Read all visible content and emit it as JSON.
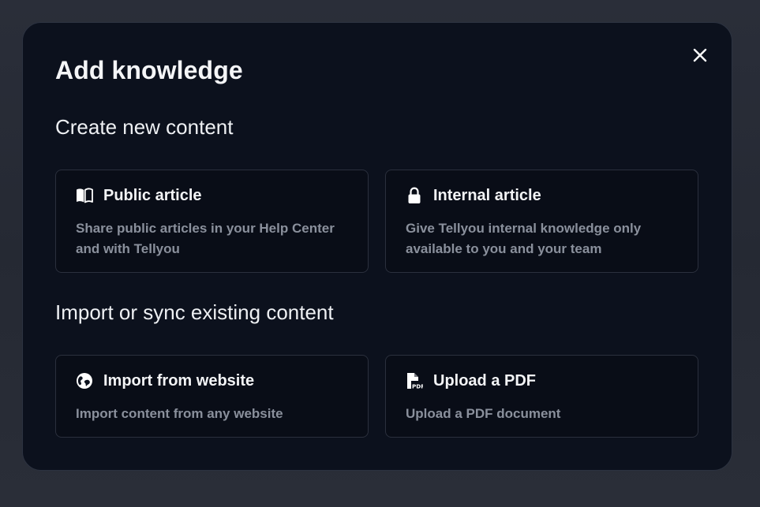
{
  "modal": {
    "title": "Add knowledge",
    "close_icon": "close-icon"
  },
  "sections": [
    {
      "title": "Create new content",
      "cards": [
        {
          "icon": "book-open-icon",
          "title": "Public article",
          "description": "Share public articles in your Help Center and with Tellyou"
        },
        {
          "icon": "lock-icon",
          "title": "Internal article",
          "description": "Give Tellyou internal knowledge only available to you and your team"
        }
      ]
    },
    {
      "title": "Import or sync existing content",
      "cards": [
        {
          "icon": "globe-icon",
          "title": "Import from website",
          "description": "Import content from any website"
        },
        {
          "icon": "pdf-file-icon",
          "title": "Upload a PDF",
          "description": "Upload a PDF document"
        }
      ]
    }
  ],
  "colors": {
    "page_background": "#272b36",
    "modal_background": "#0c111d",
    "card_background": "#090d17",
    "border": "#2b303d",
    "text_primary": "#f3f4f6",
    "text_secondary": "#8a909c"
  }
}
